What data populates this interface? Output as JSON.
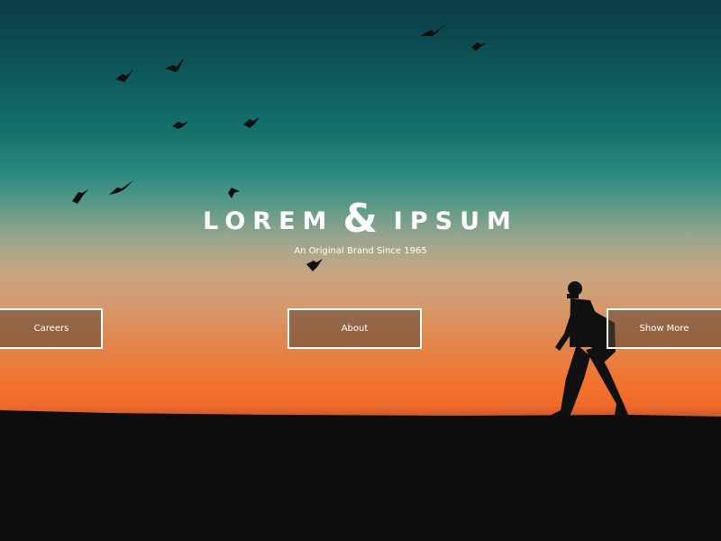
{
  "hero": {
    "title_left": "LOREM",
    "title_amp": "&",
    "title_right": "IPSUM",
    "subtitle": "An Original Brand Since 1965"
  },
  "nav": {
    "careers_label": "Careers",
    "about_label": "About",
    "show_more_label": "Show More"
  },
  "icons": {
    "birds": "bird-silhouette-icon",
    "hiker": "hiker-silhouette"
  },
  "colors": {
    "sky_top": "#0a3b48",
    "sky_mid": "#15706c",
    "horizon": "#f26f2a",
    "ground": "#0b0b0b",
    "text": "#ffffff",
    "button_border": "#ffffff"
  }
}
